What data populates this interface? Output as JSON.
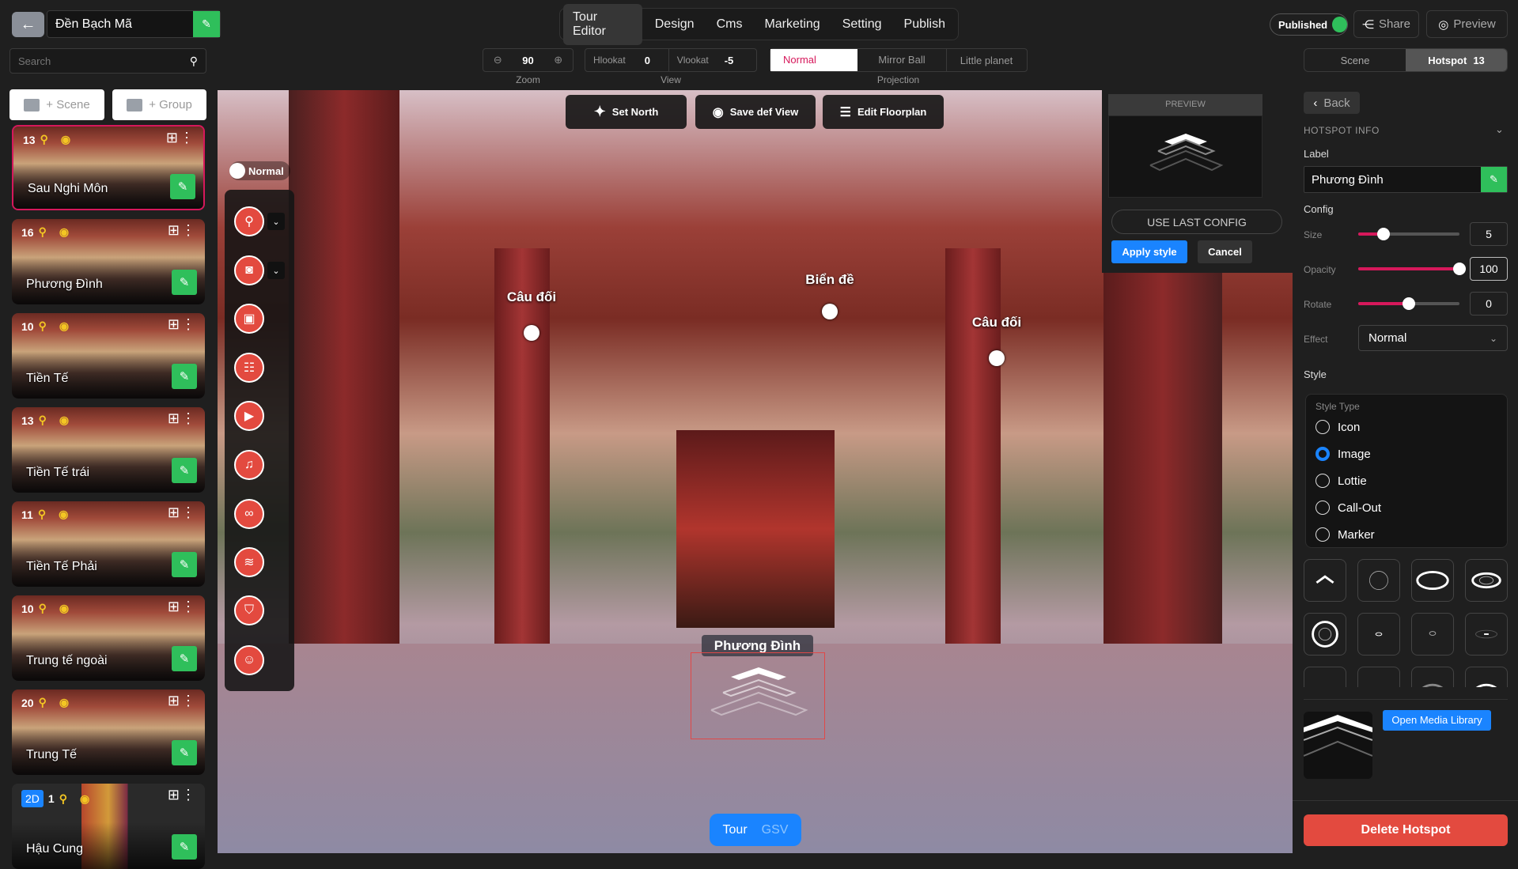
{
  "header": {
    "tour_title": "Đền Bạch Mã",
    "nav_tabs": [
      {
        "label": "Tour Editor",
        "active": true
      },
      {
        "label": "Design"
      },
      {
        "label": "Cms"
      },
      {
        "label": "Marketing"
      },
      {
        "label": "Setting"
      },
      {
        "label": "Publish"
      }
    ],
    "published_label": "Published",
    "published_on": true,
    "share_label": "Share",
    "preview_label": "Preview"
  },
  "view_controls": {
    "zoom_value": "90",
    "zoom_label": "Zoom",
    "hlookat_label": "Hlookat",
    "hlookat_value": "0",
    "vlookat_label": "Vlookat",
    "vlookat_value": "-5",
    "view_label": "View",
    "projection_options": [
      "Normal",
      "Mirror Ball",
      "Little planet"
    ],
    "projection_selected": "Normal",
    "projection_label": "Projection"
  },
  "sidebar": {
    "search_placeholder": "Search",
    "add_scene_label": "+ Scene",
    "add_group_label": "+ Group",
    "scenes": [
      {
        "name": "Sau Nghi Môn",
        "hotspots": "13",
        "selected": true
      },
      {
        "name": "Phương Đình",
        "hotspots": "16"
      },
      {
        "name": "Tiền Tế",
        "hotspots": "10"
      },
      {
        "name": "Tiền Tế trái",
        "hotspots": "13"
      },
      {
        "name": "Tiền Tế Phải",
        "hotspots": "11"
      },
      {
        "name": "Trung tế ngoài",
        "hotspots": "10"
      },
      {
        "name": "Trung Tế",
        "hotspots": "20"
      },
      {
        "name": "Hậu Cung",
        "hotspots": "1",
        "badge": "2D"
      }
    ]
  },
  "viewer": {
    "mode_toggle_label": "Normal",
    "set_north_label": "Set North",
    "save_view_label": "Save def View",
    "edit_floorplan_label": "Edit Floorplan",
    "tools": [
      "point-icon",
      "photo-icon",
      "gallery-icon",
      "article-icon",
      "video-icon",
      "music-icon",
      "link-icon",
      "layers-icon",
      "shirt-icon",
      "person-icon"
    ],
    "hotspots": [
      {
        "label": "Câu đối"
      },
      {
        "label": "Biển đề"
      },
      {
        "label": "Câu đối"
      }
    ],
    "selected_hotspot_label": "Phương Đình",
    "tour_label": "Tour",
    "gsv_label": "GSV"
  },
  "preview_popover": {
    "title": "PREVIEW",
    "use_last_config": "USE LAST CONFIG",
    "apply_label": "Apply style",
    "cancel_label": "Cancel"
  },
  "right_panel": {
    "scene_tab": "Scene",
    "hotspot_tab": "Hotspot",
    "hotspot_count": "13",
    "back_label": "Back",
    "section_title": "HOTSPOT INFO",
    "label_title": "Label",
    "label_value": "Phương Đình",
    "config_title": "Config",
    "size_label": "Size",
    "size_value": "5",
    "size_fraction": 0.25,
    "opacity_label": "Opacity",
    "opacity_value": "100",
    "opacity_fraction": 1.0,
    "rotate_label": "Rotate",
    "rotate_value": "0",
    "rotate_fraction": 0.5,
    "effect_label": "Effect",
    "effect_value": "Normal",
    "style_title": "Style",
    "style_type_title": "Style Type",
    "style_types": [
      "Icon",
      "Image",
      "Lottie",
      "Call-Out",
      "Marker"
    ],
    "style_type_selected": "Image",
    "open_media_label": "Open Media Library",
    "delete_label": "Delete Hotspot"
  },
  "colors": {
    "accent": "#d6185b",
    "green": "#2fbf5b",
    "blue": "#1a84ff",
    "danger": "#e34a3f"
  }
}
